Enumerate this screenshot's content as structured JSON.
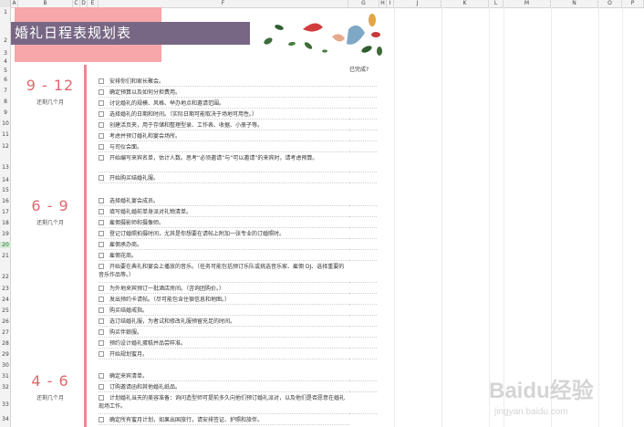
{
  "columns": [
    "A",
    "B",
    "C",
    "D",
    "E",
    "F",
    "G",
    "H",
    "I",
    "J",
    "K",
    "L",
    "M",
    "N",
    "O",
    "P"
  ],
  "rows": [
    "1",
    "2",
    "3",
    "4",
    "5",
    "6",
    "7",
    "8",
    "9",
    "10",
    "11",
    "12",
    "13",
    "14",
    "15",
    "16",
    "17",
    "18",
    "19",
    "20",
    "21",
    "22",
    "23",
    "24",
    "25",
    "26",
    "27",
    "28",
    "29",
    "30",
    "31",
    "32",
    "33",
    "34"
  ],
  "selected_row": "20",
  "title": "婚礼日程表规划表",
  "done_header": "已完成?",
  "periods": [
    {
      "range": "9 - 12",
      "sub": "还剩几个月"
    },
    {
      "range": "6 - 9",
      "sub": "还剩几个月"
    },
    {
      "range": "4 - 6",
      "sub": "还剩几个月"
    }
  ],
  "tasks_group1": [
    "安排你们和家长聚会。",
    "确定预算以及如何分担费用。",
    "讨论婚礼的规模、风格、举办地点和邀请范围。",
    "选择婚礼的日期和时间。（实际日期可能取决于场地可用性。）",
    "创建活页夹，用于存储和整理型录、工作表、收据、小册子等。",
    "考虑并预订婚礼和宴会场所。",
    "与司仪会面。",
    "开始编写来宾名单，估计人数。思考“必须邀请”与“可以邀请”的来宾时，请考虑预算。",
    "开始购买结婚礼服。"
  ],
  "tasks_group2": [
    "选择婚礼宴会成员。",
    "填写婚礼婚前单身派对礼物清单。",
    "雇佣摄影师和摄像师。",
    "登记订婚照拍摄时间，尤其是你想要在请帖上附加一张专业的订婚照时。",
    "雇佣承办商。",
    "雇佣花商。",
    "开始要在典礼和宴会上播放的音乐。（任务可能包括预订乐队或挑选音乐家、雇佣 DJ、选择重要的音乐作品等。）",
    "为外地来宾预订一批酒店房间。（咨询团购价。）",
    "发出预约卡请帖。（尽可能包含住宿信息和地图。）",
    "购买结婚戒指。",
    "选订结婚礼服，为者试和修改礼服预留充足的时间。",
    "购买伴娘服。",
    "预约设计婚礼蛋糕并品尝样准。",
    "开始规划蜜月。"
  ],
  "tasks_group3": [
    "确定来宾清单。",
    "订购邀请函和其他婚礼纸品。",
    "计划婚礼当天的美容准备：询问造型师可提前多久向他们预订婚礼派对，以及他们是否愿意在婚礼现场工作。",
    "确定所有蜜月计划，如果出国旅行，请安排签证、护照和旅伴。"
  ],
  "watermark": {
    "brand": "Baidu经验",
    "url": "jingyan.baidu.com"
  }
}
